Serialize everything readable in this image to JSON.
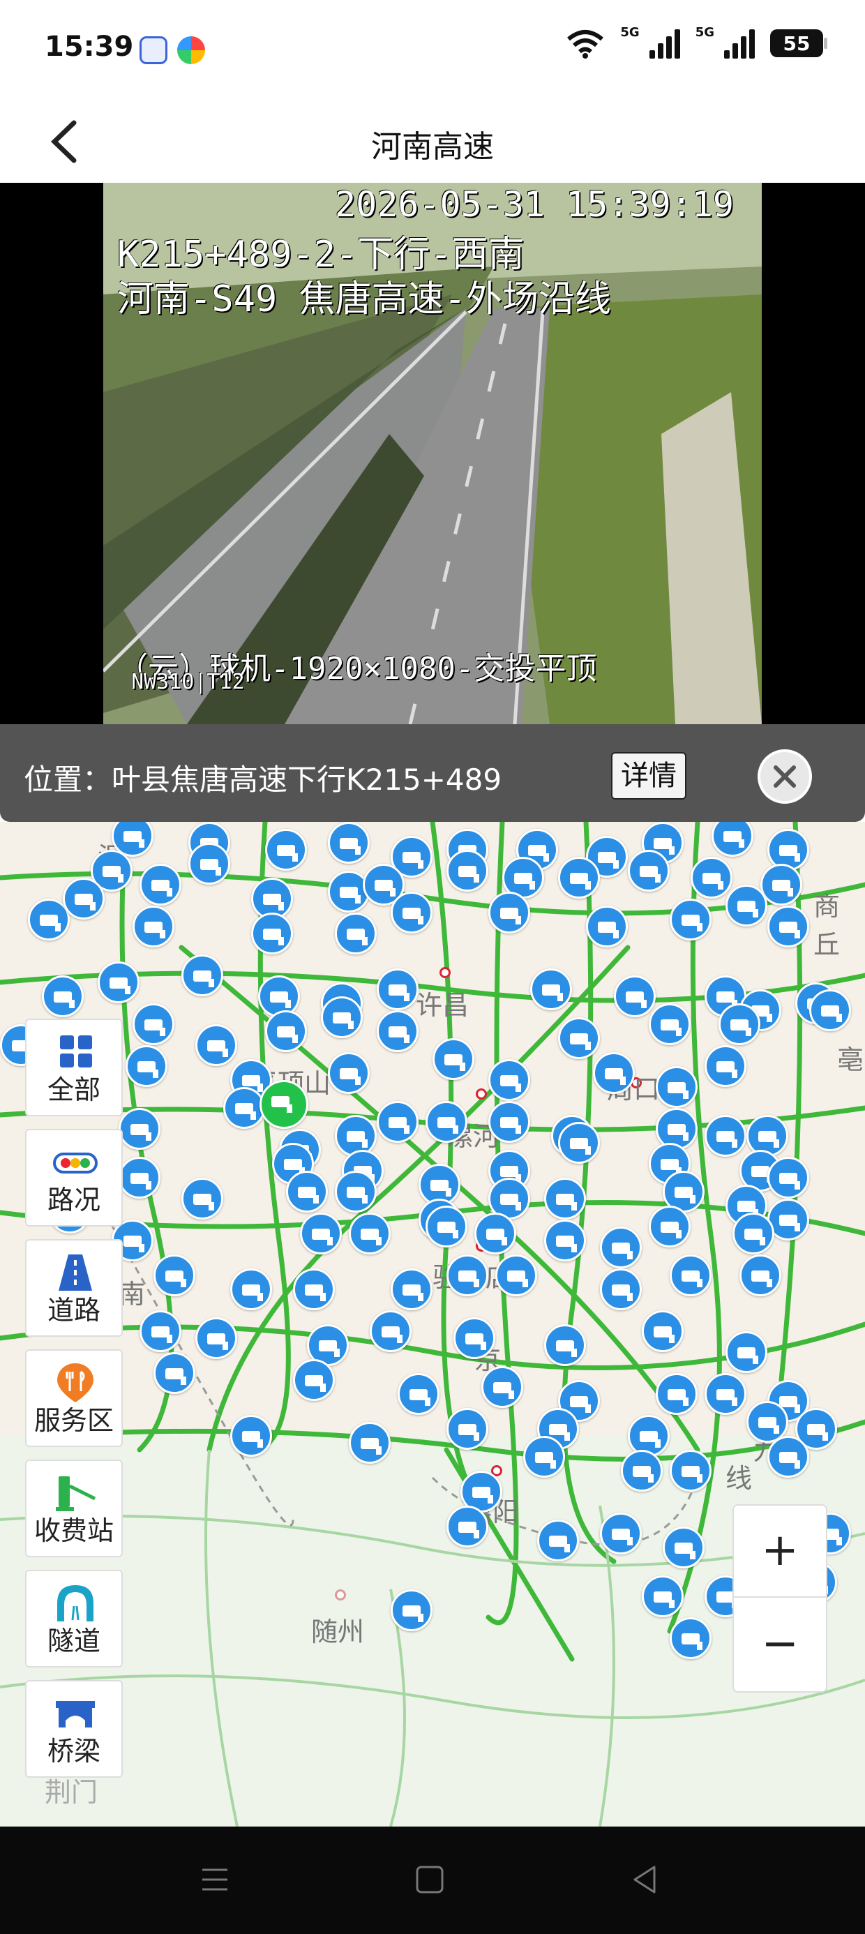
{
  "status_bar": {
    "time": "15:39",
    "battery": "55"
  },
  "header": {
    "title": "河南高速"
  },
  "video": {
    "timestamp": "2026-05-31 15:39:19",
    "line1": "K215+489-2-下行-西南",
    "line2": "河南-S49 焦唐高速-外场沿线",
    "bottom_text": "（云）球机-1920×1080-交投平顶",
    "code": "NW310|T12"
  },
  "location_bar": {
    "text": "位置：叶县焦唐高速下行K215+489",
    "detail_label": "详情"
  },
  "map": {
    "cities": [
      "许昌",
      "平顶山",
      "漯河",
      "周口",
      "驻马店",
      "信阳",
      "随州",
      "商丘",
      "荆门",
      "南",
      "京",
      "九",
      "线",
      "涅",
      "亳"
    ]
  },
  "sidebar": {
    "items": [
      {
        "label": "全部"
      },
      {
        "label": "路况"
      },
      {
        "label": "道路"
      },
      {
        "label": "服务区"
      },
      {
        "label": "收费站"
      },
      {
        "label": "隧道"
      },
      {
        "label": "桥梁"
      }
    ]
  },
  "zoom": {
    "in": "+",
    "out": "−"
  }
}
